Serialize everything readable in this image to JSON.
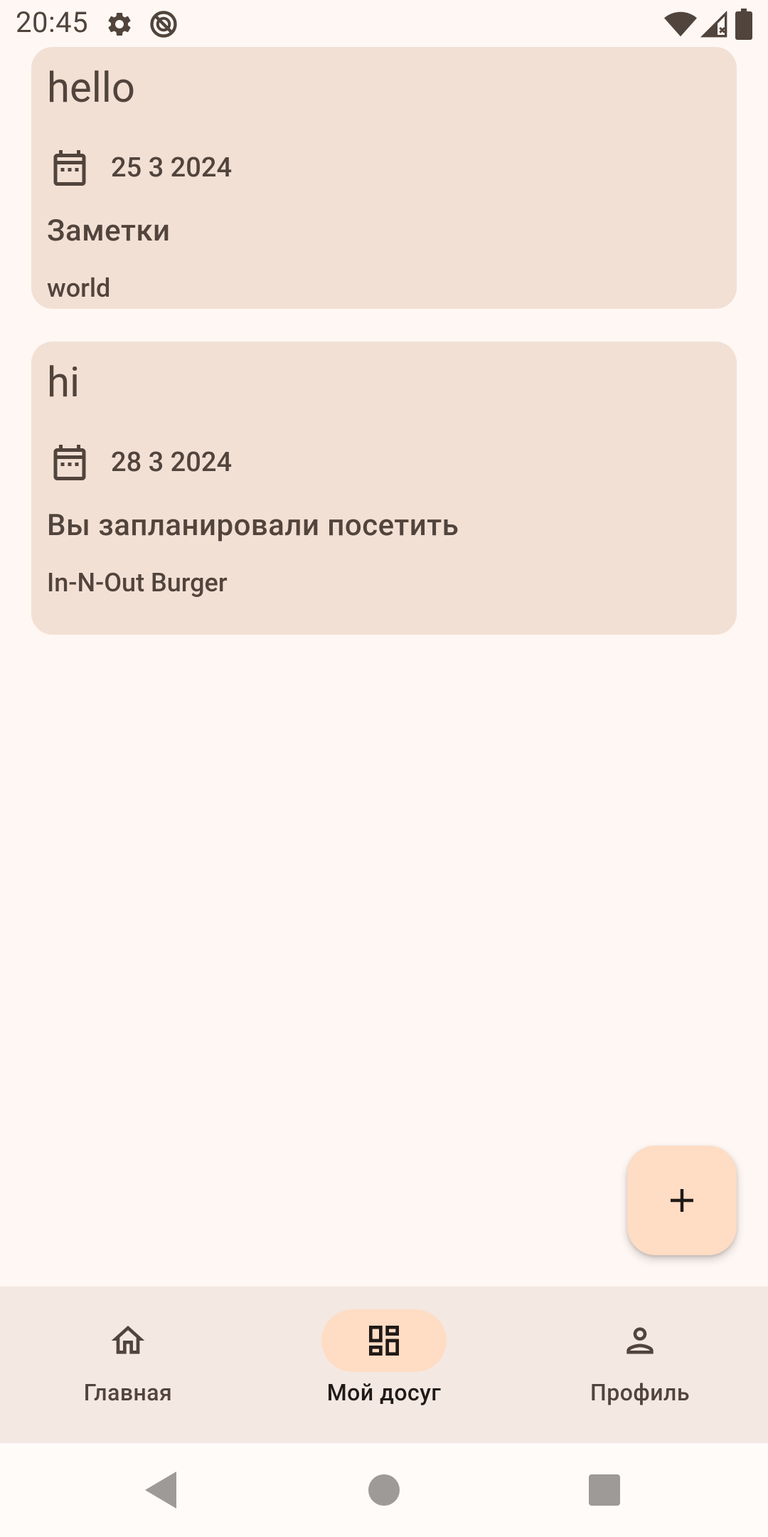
{
  "status_bar": {
    "time": "20:45",
    "icons": [
      "settings-gear-icon",
      "no-sync-icon",
      "wifi-icon",
      "cell-signal-icon",
      "battery-icon"
    ]
  },
  "cards": [
    {
      "title": "hello",
      "date": "25 3 2024",
      "category": "Заметки",
      "detail": "world"
    },
    {
      "title": "hi",
      "date": "28 3 2024",
      "category": "Вы запланировали посетить",
      "detail": "In-N-Out Burger"
    }
  ],
  "fab": {
    "icon": "plus-icon"
  },
  "bottom_nav": {
    "items": [
      {
        "label": "Главная",
        "icon": "home-icon",
        "active": false
      },
      {
        "label": "Мой досуг",
        "icon": "dashboard-icon",
        "active": true
      },
      {
        "label": "Профиль",
        "icon": "person-icon",
        "active": false
      }
    ]
  },
  "system_nav": {
    "icons": [
      "back-icon",
      "home-circle-icon",
      "recents-icon"
    ]
  },
  "colors": {
    "background": "#FFF7F3",
    "card": "#F2E0D5",
    "accent": "#FFDCC4",
    "text": "#51443C",
    "nav_bg": "#F4E8E2"
  }
}
